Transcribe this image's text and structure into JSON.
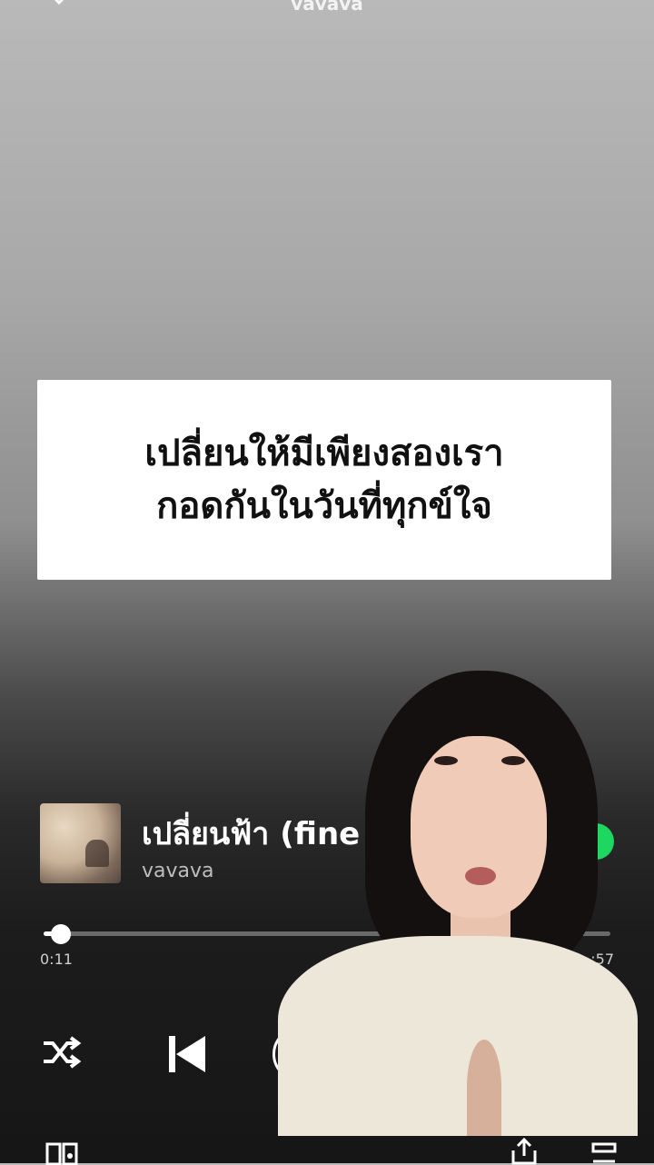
{
  "header": {
    "title": "vavava",
    "collapse_icon": "chevron-down-icon"
  },
  "lyrics": {
    "lines": [
      "เปลี่ยนให้มีเพียงสองเรา",
      "กอดกันในวันที่ทุกข์ใจ"
    ]
  },
  "now_playing": {
    "song_title": "เปลี่ยนฟ้า (fine",
    "artist": "vavava",
    "liked": true
  },
  "playback": {
    "elapsed": "0:11",
    "total": ":57",
    "progress": 0.04
  },
  "controls": {
    "shuffle_icon": "shuffle-icon",
    "previous_icon": "previous-icon",
    "play_icon": "play-icon",
    "devices_icon": "devices-icon",
    "share_icon": "share-icon",
    "queue_icon": "queue-icon"
  },
  "colors": {
    "accent": "#1ed760",
    "card_bg": "#ffffff"
  }
}
